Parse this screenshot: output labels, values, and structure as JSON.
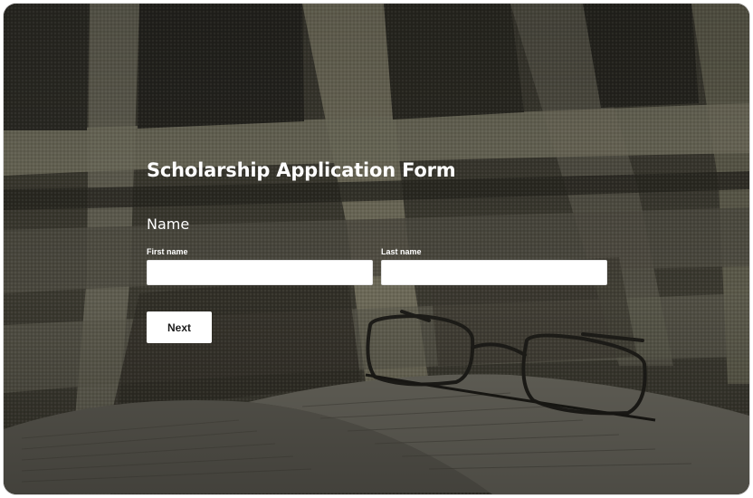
{
  "form": {
    "title": "Scholarship Application Form",
    "section_label": "Name",
    "first_name": {
      "label": "First name",
      "value": "",
      "placeholder": ""
    },
    "last_name": {
      "label": "Last name",
      "value": "",
      "placeholder": ""
    },
    "next_label": "Next"
  },
  "colors": {
    "overlay": "#2d2a24",
    "text": "#ffffff",
    "button_bg": "#ffffff"
  }
}
